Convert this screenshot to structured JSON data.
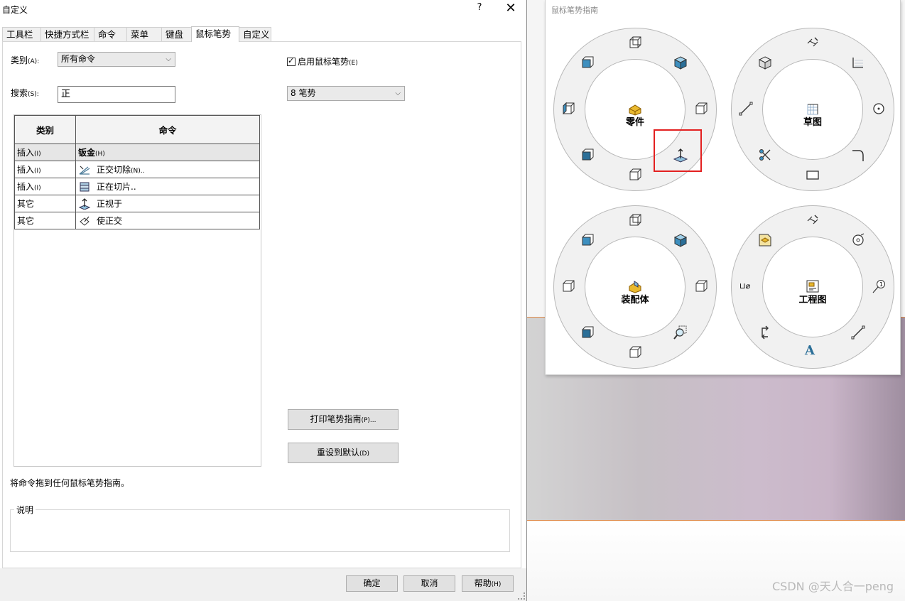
{
  "dialog": {
    "title": "自定义",
    "help_glyph": "?",
    "close_glyph": "✕",
    "tabs": [
      "工具栏",
      "快捷方式栏",
      "命令",
      "菜单",
      "键盘",
      "鼠标笔势",
      "自定义"
    ],
    "active_tab": "鼠标笔势",
    "category_label": "类别",
    "category_accel": "(A):",
    "category_value": "所有命令",
    "search_label": "搜索",
    "search_accel": "(S):",
    "search_value": "正",
    "enable_checkbox_label": "启用鼠标笔势",
    "enable_checkbox_accel": "(E)",
    "enable_checked": true,
    "gesture_count_value": "8 笔势",
    "table": {
      "headers": [
        "类别",
        "命令"
      ],
      "section": {
        "category": "插入",
        "category_accel": "(I)",
        "command": "钣金",
        "command_accel": "(H)"
      },
      "rows": [
        {
          "category": "插入",
          "category_accel": "(I)",
          "command": "正交切除",
          "command_accel": "(N)..",
          "icon": "normal-cut-icon"
        },
        {
          "category": "插入",
          "category_accel": "(I)",
          "command": "正在切片..",
          "command_accel": "",
          "icon": "slice-icon"
        },
        {
          "category": "其它",
          "category_accel": "",
          "command": "正视于",
          "command_accel": "",
          "icon": "normal-to-icon"
        },
        {
          "category": "其它",
          "category_accel": "",
          "command": "使正交",
          "command_accel": "",
          "icon": "make-normal-icon"
        }
      ]
    },
    "print_button": "打印笔势指南",
    "print_button_accel": "(P)...",
    "reset_button": "重设到默认",
    "reset_button_accel": "(D)",
    "hint_text": "将命令拖到任何鼠标笔势指南。",
    "description_label": "说明",
    "ok_button": "确定",
    "cancel_button": "取消",
    "help_button": "帮助",
    "help_button_accel": "(H)"
  },
  "guide": {
    "title": "鼠标笔势指南",
    "rings": [
      {
        "label": "零件"
      },
      {
        "label": "草图"
      },
      {
        "label": "装配体"
      },
      {
        "label": "工程图"
      }
    ],
    "drawing_text_left": "⊔⌀",
    "drawing_text_bottom": "A"
  },
  "watermark": "CSDN @天人合一peng",
  "colors": {
    "highlight": "#e32020",
    "cube_blue": "#3d8fbf",
    "part_yellow": "#e9b92f"
  }
}
